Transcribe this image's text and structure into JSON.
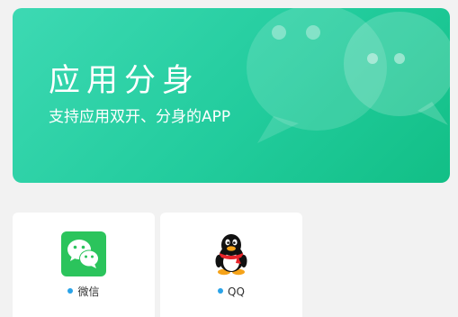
{
  "banner": {
    "title": "应用分身",
    "subtitle": "支持应用双开、分身的APP"
  },
  "apps": [
    {
      "label": "微信",
      "icon": "wechat-icon"
    },
    {
      "label": "QQ",
      "icon": "qq-penguin-icon"
    }
  ],
  "colors": {
    "banner_start": "#3dd9b3",
    "banner_end": "#12bf86",
    "wechat_green": "#2bc45c",
    "status_dot": "#2aa3e8",
    "background": "#f2f2f2"
  }
}
